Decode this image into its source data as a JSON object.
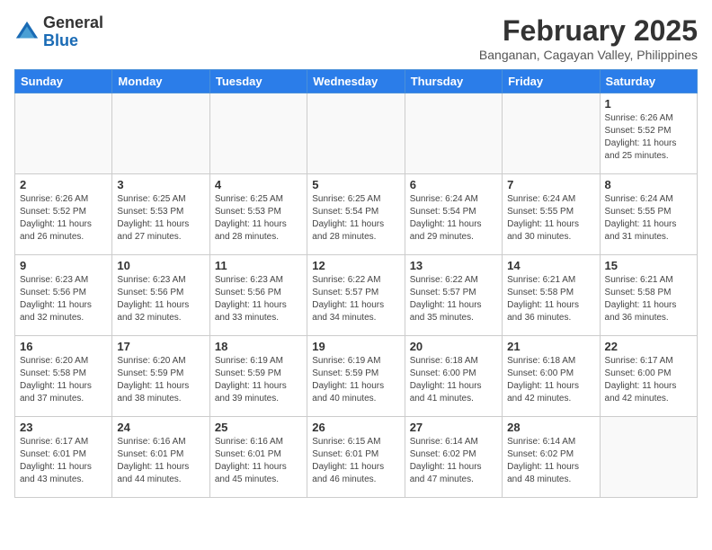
{
  "header": {
    "logo_general": "General",
    "logo_blue": "Blue",
    "month_title": "February 2025",
    "location": "Banganan, Cagayan Valley, Philippines"
  },
  "calendar": {
    "weekdays": [
      "Sunday",
      "Monday",
      "Tuesday",
      "Wednesday",
      "Thursday",
      "Friday",
      "Saturday"
    ],
    "weeks": [
      [
        {
          "day": "",
          "info": ""
        },
        {
          "day": "",
          "info": ""
        },
        {
          "day": "",
          "info": ""
        },
        {
          "day": "",
          "info": ""
        },
        {
          "day": "",
          "info": ""
        },
        {
          "day": "",
          "info": ""
        },
        {
          "day": "1",
          "info": "Sunrise: 6:26 AM\nSunset: 5:52 PM\nDaylight: 11 hours and 25 minutes."
        }
      ],
      [
        {
          "day": "2",
          "info": "Sunrise: 6:26 AM\nSunset: 5:52 PM\nDaylight: 11 hours and 26 minutes."
        },
        {
          "day": "3",
          "info": "Sunrise: 6:25 AM\nSunset: 5:53 PM\nDaylight: 11 hours and 27 minutes."
        },
        {
          "day": "4",
          "info": "Sunrise: 6:25 AM\nSunset: 5:53 PM\nDaylight: 11 hours and 28 minutes."
        },
        {
          "day": "5",
          "info": "Sunrise: 6:25 AM\nSunset: 5:54 PM\nDaylight: 11 hours and 28 minutes."
        },
        {
          "day": "6",
          "info": "Sunrise: 6:24 AM\nSunset: 5:54 PM\nDaylight: 11 hours and 29 minutes."
        },
        {
          "day": "7",
          "info": "Sunrise: 6:24 AM\nSunset: 5:55 PM\nDaylight: 11 hours and 30 minutes."
        },
        {
          "day": "8",
          "info": "Sunrise: 6:24 AM\nSunset: 5:55 PM\nDaylight: 11 hours and 31 minutes."
        }
      ],
      [
        {
          "day": "9",
          "info": "Sunrise: 6:23 AM\nSunset: 5:56 PM\nDaylight: 11 hours and 32 minutes."
        },
        {
          "day": "10",
          "info": "Sunrise: 6:23 AM\nSunset: 5:56 PM\nDaylight: 11 hours and 32 minutes."
        },
        {
          "day": "11",
          "info": "Sunrise: 6:23 AM\nSunset: 5:56 PM\nDaylight: 11 hours and 33 minutes."
        },
        {
          "day": "12",
          "info": "Sunrise: 6:22 AM\nSunset: 5:57 PM\nDaylight: 11 hours and 34 minutes."
        },
        {
          "day": "13",
          "info": "Sunrise: 6:22 AM\nSunset: 5:57 PM\nDaylight: 11 hours and 35 minutes."
        },
        {
          "day": "14",
          "info": "Sunrise: 6:21 AM\nSunset: 5:58 PM\nDaylight: 11 hours and 36 minutes."
        },
        {
          "day": "15",
          "info": "Sunrise: 6:21 AM\nSunset: 5:58 PM\nDaylight: 11 hours and 36 minutes."
        }
      ],
      [
        {
          "day": "16",
          "info": "Sunrise: 6:20 AM\nSunset: 5:58 PM\nDaylight: 11 hours and 37 minutes."
        },
        {
          "day": "17",
          "info": "Sunrise: 6:20 AM\nSunset: 5:59 PM\nDaylight: 11 hours and 38 minutes."
        },
        {
          "day": "18",
          "info": "Sunrise: 6:19 AM\nSunset: 5:59 PM\nDaylight: 11 hours and 39 minutes."
        },
        {
          "day": "19",
          "info": "Sunrise: 6:19 AM\nSunset: 5:59 PM\nDaylight: 11 hours and 40 minutes."
        },
        {
          "day": "20",
          "info": "Sunrise: 6:18 AM\nSunset: 6:00 PM\nDaylight: 11 hours and 41 minutes."
        },
        {
          "day": "21",
          "info": "Sunrise: 6:18 AM\nSunset: 6:00 PM\nDaylight: 11 hours and 42 minutes."
        },
        {
          "day": "22",
          "info": "Sunrise: 6:17 AM\nSunset: 6:00 PM\nDaylight: 11 hours and 42 minutes."
        }
      ],
      [
        {
          "day": "23",
          "info": "Sunrise: 6:17 AM\nSunset: 6:01 PM\nDaylight: 11 hours and 43 minutes."
        },
        {
          "day": "24",
          "info": "Sunrise: 6:16 AM\nSunset: 6:01 PM\nDaylight: 11 hours and 44 minutes."
        },
        {
          "day": "25",
          "info": "Sunrise: 6:16 AM\nSunset: 6:01 PM\nDaylight: 11 hours and 45 minutes."
        },
        {
          "day": "26",
          "info": "Sunrise: 6:15 AM\nSunset: 6:01 PM\nDaylight: 11 hours and 46 minutes."
        },
        {
          "day": "27",
          "info": "Sunrise: 6:14 AM\nSunset: 6:02 PM\nDaylight: 11 hours and 47 minutes."
        },
        {
          "day": "28",
          "info": "Sunrise: 6:14 AM\nSunset: 6:02 PM\nDaylight: 11 hours and 48 minutes."
        },
        {
          "day": "",
          "info": ""
        }
      ]
    ]
  }
}
